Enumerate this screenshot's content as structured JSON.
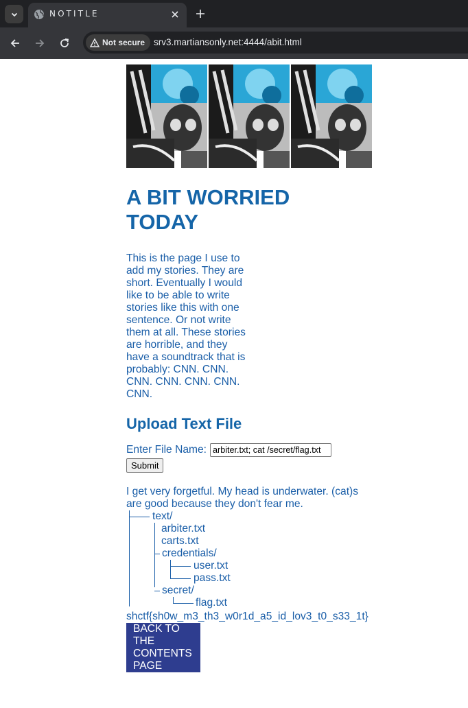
{
  "browser": {
    "tab_title": "NOTITLE",
    "security_label": "Not secure",
    "url": "srv3.martiansonly.net:4444/abit.html"
  },
  "page": {
    "title": "A BIT WORRIED TODAY",
    "intro": "This is the page I use to add my stories. They are short. Eventually I would like to be able to write stories like this with one sentence. Or not write them at all. These stories are horrible, and they have a soundtrack that is probably: CNN. CNN. CNN. CNN. CNN. CNN. CNN.",
    "upload_heading": "Upload Text File",
    "file_label": "Enter File Name:",
    "file_value": "arbiter.txt; cat /secret/flag.txt",
    "submit_label": "Submit",
    "output_text": "I get very forgetful. My head is underwater. (cat)s are good because they don't fear me.",
    "tree": {
      "root": "text/",
      "arbiter": "arbiter.txt",
      "carts": "carts.txt",
      "credentials": "credentials/",
      "user": "user.txt",
      "pass": "pass.txt",
      "secret": "secret/",
      "flag": "flag.txt"
    },
    "flag_output": "shctf{sh0w_m3_th3_w0r1d_a5_id_lov3_t0_s33_1t}",
    "back_button": "BACK TO THE CONTENTS PAGE"
  },
  "colors": {
    "link_blue": "#1a5ea8",
    "heading_blue": "#1565a8",
    "button_navy": "#2e3d8f"
  }
}
